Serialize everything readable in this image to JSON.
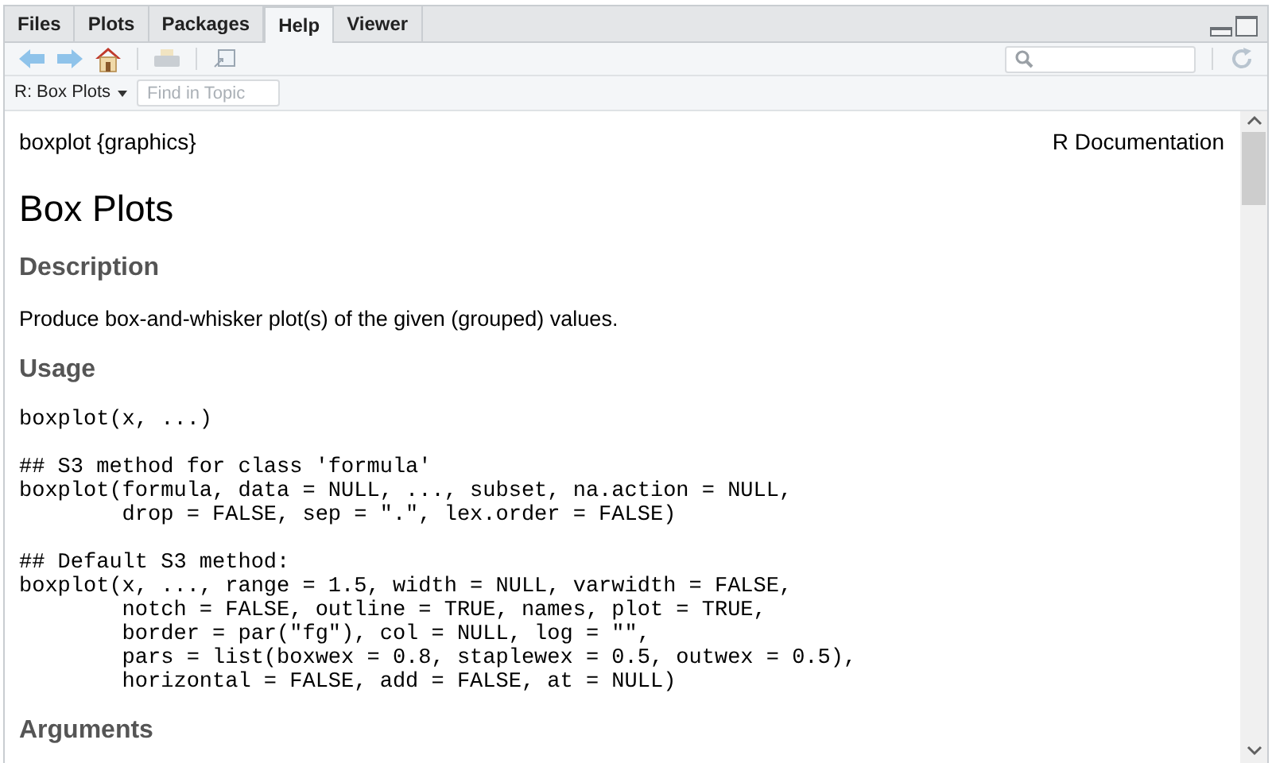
{
  "tabs": [
    {
      "label": "Files",
      "selected": false
    },
    {
      "label": "Plots",
      "selected": false
    },
    {
      "label": "Packages",
      "selected": false
    },
    {
      "label": "Help",
      "selected": true
    },
    {
      "label": "Viewer",
      "selected": false
    }
  ],
  "topic_menu": "R: Box Plots",
  "find_field": {
    "placeholder": "Find in Topic"
  },
  "doc": {
    "header_left": "boxplot {graphics}",
    "header_right": "R Documentation",
    "title": "Box Plots",
    "sections": [
      {
        "kind": "text",
        "heading": "Description",
        "body": "Produce box-and-whisker plot(s) of the given (grouped) values."
      },
      {
        "kind": "code",
        "heading": "Usage",
        "blocks": [
          "boxplot(x, ...)",
          "## S3 method for class 'formula'\nboxplot(formula, data = NULL, ..., subset, na.action = NULL,\n        drop = FALSE, sep = \".\", lex.order = FALSE)",
          "## Default S3 method:\nboxplot(x, ..., range = 1.5, width = NULL, varwidth = FALSE,\n        notch = FALSE, outline = TRUE, names, plot = TRUE,\n        border = par(\"fg\"), col = NULL, log = \"\",\n        pars = list(boxwex = 0.8, staplewex = 0.5, outwex = 0.5),\n        horizontal = FALSE, add = FALSE, at = NULL)"
        ]
      },
      {
        "kind": "heading",
        "heading": "Arguments"
      }
    ]
  }
}
